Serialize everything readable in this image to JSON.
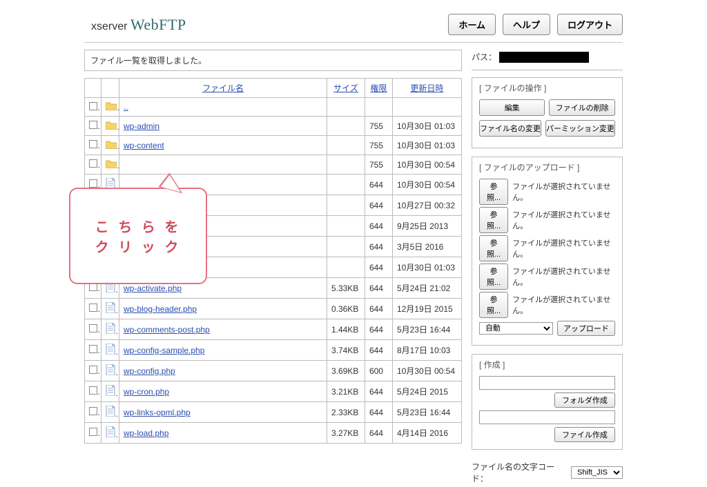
{
  "logo": {
    "prefix": "xserver ",
    "main": "WebFTP"
  },
  "header_buttons": {
    "home": "ホーム",
    "help": "ヘルプ",
    "logout": "ログアウト"
  },
  "status_message": "ファイル一覧を取得しました。",
  "path": {
    "label": "パス：",
    "value": "██████████████"
  },
  "columns": {
    "name": "ファイル名",
    "size": "サイズ",
    "perm": "権限",
    "date": "更新日時"
  },
  "callout": "こ ち ら を\nク リ ッ ク",
  "rows": [
    {
      "type": "folder",
      "name": "..",
      "size": "",
      "perm": "",
      "date": ""
    },
    {
      "type": "folder",
      "name": "wp-admin",
      "size": "",
      "perm": "755",
      "date": "10月30日 01:03"
    },
    {
      "type": "folder",
      "name": "wp-content",
      "size": "",
      "perm": "755",
      "date": "10月30日 01:03"
    },
    {
      "type": "folder",
      "name": "",
      "size": "",
      "perm": "755",
      "date": "10月30日 00:54"
    },
    {
      "type": "file",
      "name": "",
      "size": "",
      "perm": "644",
      "date": "10月30日 00:54"
    },
    {
      "type": "file",
      "name": "",
      "size": "",
      "perm": "644",
      "date": "10月27日 00:32"
    },
    {
      "type": "file",
      "name": "",
      "size": "",
      "perm": "644",
      "date": "9月25日 2013"
    },
    {
      "type": "file",
      "name": "",
      "size": "",
      "perm": "644",
      "date": "3月5日 2016"
    },
    {
      "type": "file",
      "name": "",
      "size": "",
      "perm": "644",
      "date": "10月30日 01:03"
    },
    {
      "type": "file",
      "name": "wp-activate.php",
      "size": "5.33KB",
      "perm": "644",
      "date": "5月24日 21:02"
    },
    {
      "type": "file",
      "name": "wp-blog-header.php",
      "size": "0.36KB",
      "perm": "644",
      "date": "12月19日 2015"
    },
    {
      "type": "file",
      "name": "wp-comments-post.php",
      "size": "1.44KB",
      "perm": "644",
      "date": "5月23日 16:44"
    },
    {
      "type": "file",
      "name": "wp-config-sample.php",
      "size": "3.74KB",
      "perm": "644",
      "date": "8月17日 10:03"
    },
    {
      "type": "file",
      "name": "wp-config.php",
      "size": "3.69KB",
      "perm": "600",
      "date": "10月30日 00:54"
    },
    {
      "type": "file",
      "name": "wp-cron.php",
      "size": "3.21KB",
      "perm": "644",
      "date": "5月24日 2015"
    },
    {
      "type": "file",
      "name": "wp-links-opml.php",
      "size": "2.33KB",
      "perm": "644",
      "date": "5月23日 16:44"
    },
    {
      "type": "file",
      "name": "wp-load.php",
      "size": "3.27KB",
      "perm": "644",
      "date": "4月14日 2016"
    }
  ],
  "ops": {
    "title": "[ ファイルの操作 ]",
    "edit": "編集",
    "delete": "ファイルの削除",
    "rename": "ファイル名の変更",
    "chmod": "パーミッション変更"
  },
  "upload": {
    "title": "[ ファイルのアップロード ]",
    "browse": "参照...",
    "nofile": "ファイルが選択されていません。",
    "count": 5,
    "encoding_auto": "自動",
    "upload_btn": "アップロード"
  },
  "create": {
    "title": "[ 作成 ]",
    "mkdir": "フォルダ作成",
    "mkfile": "ファイル作成"
  },
  "encode": {
    "label": "ファイル名の文字コード：",
    "value": "Shift_JIS"
  }
}
